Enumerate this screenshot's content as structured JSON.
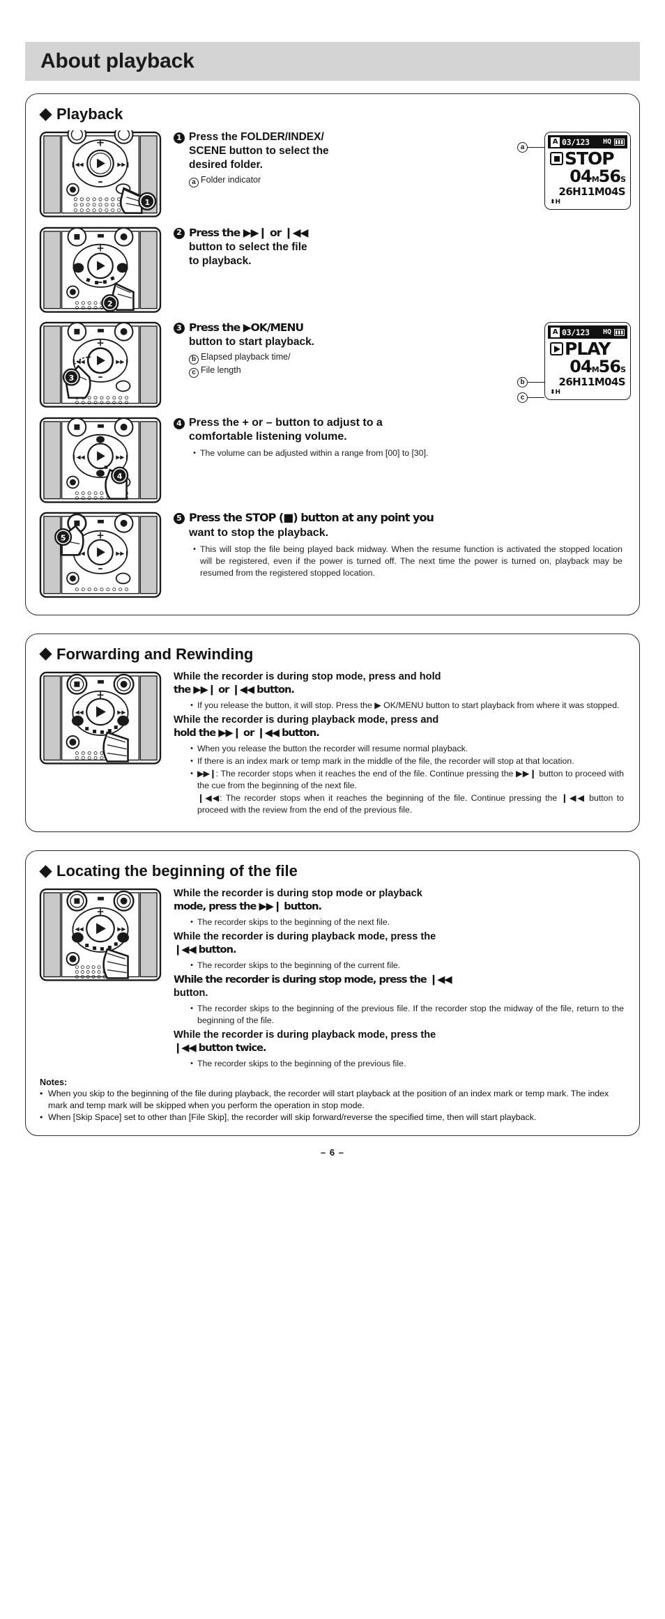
{
  "page": {
    "title": "About playback",
    "page_number": "– 6 –"
  },
  "sections": [
    {
      "heading": "Playback"
    },
    {
      "heading": "Forwarding and Rewinding"
    },
    {
      "heading": "Locating the beginning of the file"
    }
  ],
  "playback_steps": [
    {
      "number": "1",
      "head_line1": "Press the FOLDER/INDEX/",
      "head_line2": "SCENE button to select the",
      "head_line3": "desired folder.",
      "sub_letter": "a",
      "sub_text": "Folder indicator",
      "callout": "1"
    },
    {
      "number": "2",
      "head_line1": "Press the ▶▶❙  or ❙◀◀",
      "head_line2": "button to select the file",
      "head_line3": "to playback.",
      "callout": "2"
    },
    {
      "number": "3",
      "head_line1": "Press the ▶OK/MENU",
      "head_line2": "button to start playback.",
      "sub_letter_b": "b",
      "sub_text_b": "Elapsed playback time/",
      "sub_letter_c": "c",
      "sub_text_c": "File length",
      "callout": "3"
    },
    {
      "number": "4",
      "head_line1": "Press the + or – button to adjust to a",
      "head_line2": "comfortable listening volume.",
      "bullets": [
        "The volume can be adjusted within a range from [00] to [30]."
      ],
      "callout": "4"
    },
    {
      "number": "5",
      "head_line1": "Press the STOP (■) button at any point you",
      "head_line2": "want to stop the playback.",
      "bullets": [
        "This will stop the file being played back midway. When the resume function is activated the stopped location will be registered, even if the power is turned off. The next time the power is turned on, playback may be resumed from the registered stopped location."
      ],
      "callout": "5"
    }
  ],
  "lcd_stop": {
    "folder_indicator": "A",
    "file_number": "03/123",
    "quality": "HQ",
    "battery": "battery-icon",
    "mode_icon": "stop-icon",
    "mode_label": "STOP",
    "elapsed_minutes": "04",
    "elapsed_minutes_unit": "M",
    "elapsed_seconds": "56",
    "elapsed_seconds_unit": "S",
    "length": "26H11M04S",
    "mic_indicator": "H"
  },
  "lcd_play": {
    "folder_indicator": "A",
    "file_number": "03/123",
    "quality": "HQ",
    "battery": "battery-icon",
    "mode_icon": "play-icon",
    "mode_label": "PLAY",
    "elapsed_minutes": "04",
    "elapsed_minutes_unit": "M",
    "elapsed_seconds": "56",
    "elapsed_seconds_unit": "S",
    "length": "26H11M04S",
    "mic_indicator": "H",
    "callout_b": "b",
    "callout_c": "c"
  },
  "callout_a": "a",
  "forwarding": {
    "head1_l1": "While the recorder is during stop mode, press and hold",
    "head1_l2": "the ▶▶❙ or ❙◀◀ button.",
    "bullets1": [
      "If you release the button, it will stop. Press the ▶ OK/MENU button to start playback from where it was stopped."
    ],
    "head2_l1": "While the recorder is during playback mode, press and",
    "head2_l2": "hold the ▶▶❙ or ❙◀◀ button.",
    "bullets2": [
      "When you release the button the recorder will resume normal playback.",
      "If there is an index mark or temp mark in the middle of the file, the recorder will stop at that location."
    ],
    "ff_label": "▶▶❙",
    "ff_text": ":  The recorder stops when it reaches the end of the file. Continue pressing the ▶▶❙ button to proceed with the cue from the beginning of the next file.",
    "rew_label": "❙◀◀",
    "rew_text": ":  The recorder stops when it reaches the beginning of the file. Continue pressing the ❙◀◀ button to proceed with the review from the end of the previous file."
  },
  "locating": {
    "head1_l1": "While the recorder is during stop mode or playback",
    "head1_l2": "mode, press the ▶▶❙ button.",
    "bullets1": [
      "The recorder skips to the beginning of the next file."
    ],
    "head2_l1": "While the recorder is during playback mode, press the",
    "head2_l2": "❙◀◀ button.",
    "bullets2": [
      "The recorder skips to the beginning of the current file."
    ],
    "head3_l1": "While the recorder is during stop mode, press the ❙◀◀",
    "head3_l2": "button.",
    "bullets3": [
      "The recorder skips to the beginning of the previous file. If the recorder stop the midway of the file, return to the beginning of the file."
    ],
    "head4_l1": "While the recorder is during playback mode, press the",
    "head4_l2": "❙◀◀ button twice.",
    "bullets4": [
      "The recorder skips to the beginning of the previous file."
    ]
  },
  "notes": {
    "title": "Notes:",
    "items": [
      "When you skip to the beginning of the file during playback, the recorder will start playback at the position of an index mark or temp mark. The index mark and temp mark will be skipped when you perform the operation in stop mode.",
      "When [Skip Space] set to other than [File Skip], the recorder will skip forward/reverse the specified time, then will start playback."
    ]
  },
  "colors": {
    "banner": "#d4d4d4",
    "device_side": "#c9c9c9",
    "ink": "#1a1a1a"
  }
}
